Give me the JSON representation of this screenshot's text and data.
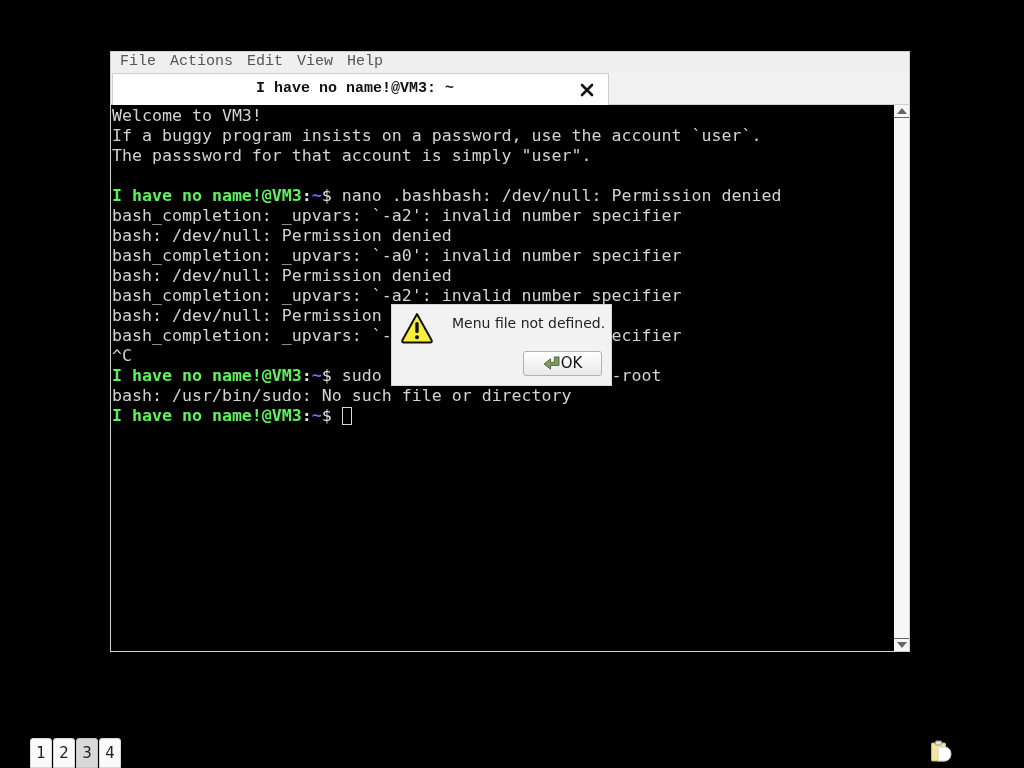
{
  "menu_bar": [
    "File",
    "Actions",
    "Edit",
    "View",
    "Help"
  ],
  "tabs": [
    {
      "title": "I have no name!@VM3: ~",
      "selected": true
    }
  ],
  "terminal": {
    "lines": [
      {
        "kind": "output",
        "text": "Welcome to VM3!"
      },
      {
        "kind": "output",
        "text": "If a buggy program insists on a password, use the account `user`."
      },
      {
        "kind": "output",
        "text": "The passsword for that account is simply \"user\"."
      },
      {
        "kind": "blank"
      },
      {
        "kind": "prompt",
        "user_host": "I have no name!@VM3",
        "separator": ":",
        "path": "~",
        "symbol": "$",
        "command": "nano .bashbash: /dev/null: Permission denied"
      },
      {
        "kind": "output",
        "text": "bash_completion: _upvars: `-a2': invalid number specifier"
      },
      {
        "kind": "output",
        "text": "bash: /dev/null: Permission denied"
      },
      {
        "kind": "output",
        "text": "bash_completion: _upvars: `-a0': invalid number specifier"
      },
      {
        "kind": "output",
        "text": "bash: /dev/null: Permission denied"
      },
      {
        "kind": "output",
        "text": "bash_completion: _upvars: `-a2': invalid number specifier"
      },
      {
        "kind": "output",
        "text": "bash: /dev/null: Permission"
      },
      {
        "kind": "output",
        "text": "bash_completion: _upvars: `-",
        "tail": "ecifier"
      },
      {
        "kind": "output",
        "text": "^C"
      },
      {
        "kind": "prompt",
        "user_host": "I have no name!@VM3",
        "separator": ":",
        "path": "~",
        "symbol": "$",
        "command": "sudo",
        "tail": "-root"
      },
      {
        "kind": "output",
        "text": "bash: /usr/bin/sudo: No such file or directory"
      },
      {
        "kind": "prompt",
        "user_host": "I have no name!@VM3",
        "separator": ":",
        "path": "~",
        "symbol": "$",
        "cursor": true
      }
    ]
  },
  "dialog": {
    "message": "Menu file not defined.",
    "button": "OK"
  },
  "pager": [
    {
      "label": "1",
      "selected": false
    },
    {
      "label": "2",
      "selected": false
    },
    {
      "label": "3",
      "selected": true
    },
    {
      "label": "4",
      "selected": false
    }
  ]
}
